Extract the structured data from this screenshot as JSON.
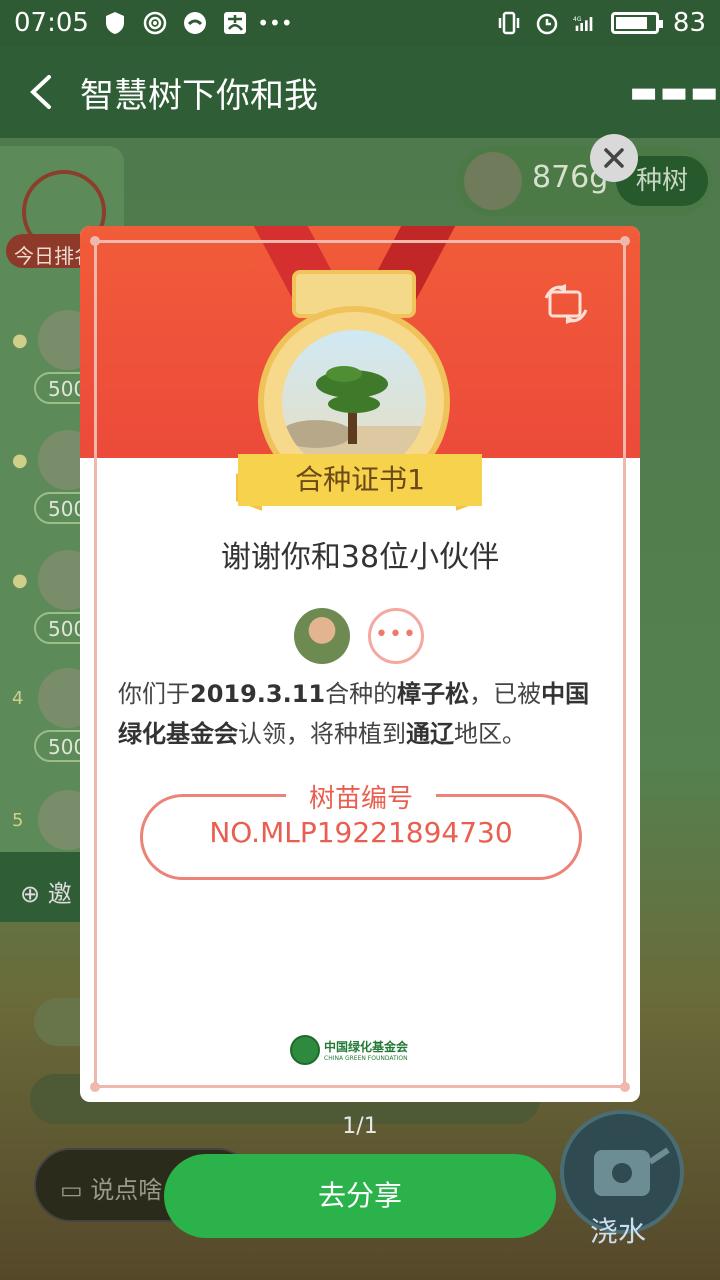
{
  "status_bar": {
    "time": "07:05",
    "battery": "83",
    "battery_level": 0.83,
    "network": "4G"
  },
  "header": {
    "title": "智慧树下你和我"
  },
  "background": {
    "today_rank_label": "今日排名",
    "energy": "876g",
    "plant_button": "种树",
    "rank_values": [
      "500",
      "500",
      "500",
      "500"
    ],
    "rank_numbers": [
      "4",
      "5"
    ],
    "invite_label": "邀",
    "chat_placeholder": "说点啥",
    "water_label": "浇水"
  },
  "certificate": {
    "badge_title": "合种证书1",
    "thanks": "谢谢你和38位小伙伴",
    "more_dots": "•••",
    "desc_prefix": "你们于",
    "date": "2019.3.11",
    "desc_mid1": "合种的",
    "tree_name": "樟子松",
    "desc_mid2": "，已被",
    "foundation_name": "中国绿化基金会",
    "desc_mid3": "认领，将种植到",
    "region": "通辽",
    "desc_suffix": "地区。",
    "seedling_label": "树苗编号",
    "seedling_number": "NO.MLP19221894730",
    "logo_cn": "中国绿化基金会",
    "logo_en": "CHINA GREEN FOUNDATION"
  },
  "pager": "1/1",
  "share_button": "去分享",
  "colors": {
    "card_header": "#ef5239",
    "accent_red": "#ea5e4f",
    "share_green": "#2bb24a",
    "medal_gold": "#f6d24d"
  }
}
